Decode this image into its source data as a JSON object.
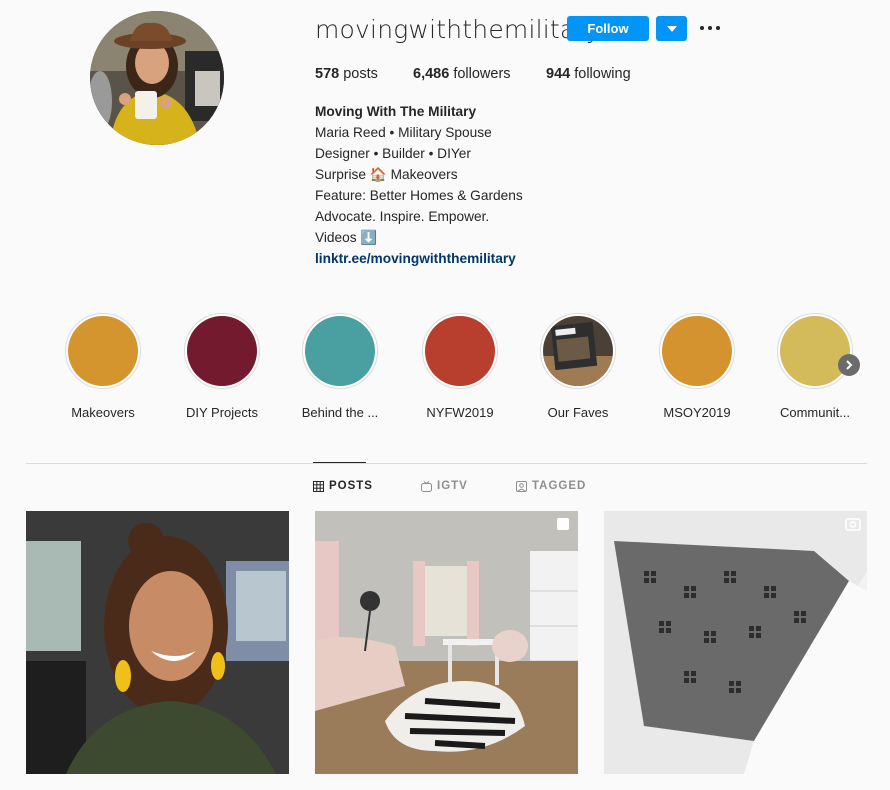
{
  "profile": {
    "username": "movingwiththemilitary",
    "follow_label": "Follow",
    "stats": {
      "posts_count": "578",
      "posts_label": " posts",
      "followers_count": "6,486",
      "followers_label": " followers",
      "following_count": "944",
      "following_label": " following"
    },
    "bio": {
      "name": "Moving With The Military",
      "lines": [
        "Maria Reed • Military Spouse",
        "Designer • Builder • DIYer",
        "Surprise 🏠 Makeovers",
        "Feature: Better Homes & Gardens",
        "Advocate. Inspire. Empower.",
        "Videos ⬇️"
      ],
      "link": "linktr.ee/movingwiththemilitary"
    }
  },
  "highlights": [
    {
      "label": "Makeovers",
      "color": "#d4952f"
    },
    {
      "label": "DIY Projects",
      "color": "#731a2f"
    },
    {
      "label": "Behind the ...",
      "color": "#4aa0a1"
    },
    {
      "label": "NYFW2019",
      "color": "#b83e2e"
    },
    {
      "label": "Our Faves",
      "color": "#6a5a45"
    },
    {
      "label": "MSOY2019",
      "color": "#d4932e"
    },
    {
      "label": "Communit...",
      "color": "#d3bb5c"
    }
  ],
  "tabs": [
    {
      "label": "POSTS",
      "icon": "grid-icon",
      "active": true
    },
    {
      "label": "IGTV",
      "icon": "igtv-icon",
      "active": false
    },
    {
      "label": "TAGGED",
      "icon": "tagged-icon",
      "active": false
    }
  ],
  "posts": [
    {
      "subject": "woman-selfie-in-car"
    },
    {
      "subject": "office-room-with-zebra-rug",
      "badge": "carousel-icon"
    },
    {
      "subject": "drawer-project-closeup",
      "badge": "video-icon"
    }
  ]
}
